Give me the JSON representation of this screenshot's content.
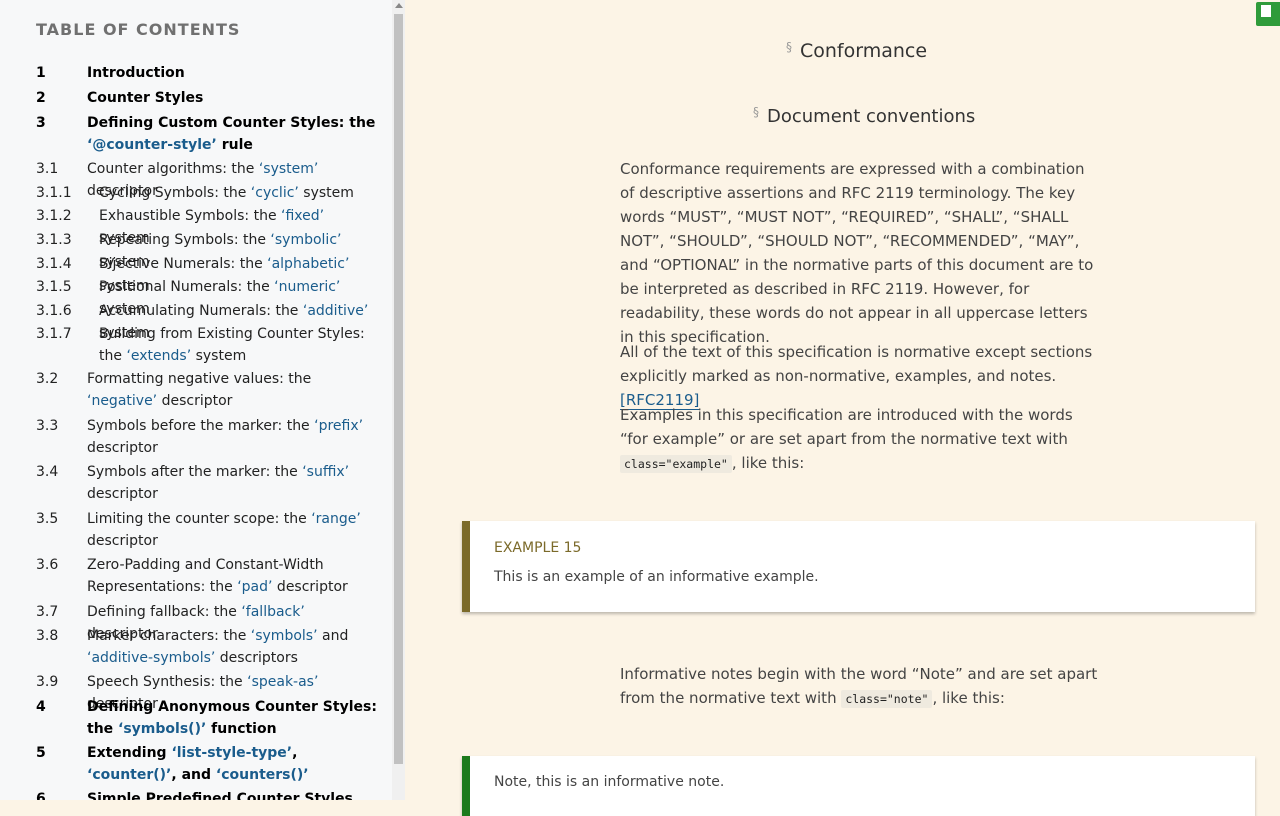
{
  "toc": {
    "title": "TABLE OF CONTENTS",
    "entries": [
      {
        "num": "1",
        "pre": "Introduction",
        "link": "",
        "post": ""
      },
      {
        "num": "2",
        "pre": "Counter Styles",
        "link": "",
        "post": ""
      },
      {
        "num": "3",
        "pre": "Defining Custom Counter Styles: the ",
        "link": "‘@counter-style’",
        "post": " rule"
      },
      {
        "num": "3.1",
        "pre": "Counter algorithms: the ",
        "link": "‘system’",
        "post": " descriptor"
      },
      {
        "num": "3.1.1",
        "pre": "Cycling Symbols: the ",
        "link": "‘cyclic’",
        "post": " system"
      },
      {
        "num": "3.1.2",
        "pre": "Exhaustible Symbols: the ",
        "link": "‘fixed’",
        "post": " system"
      },
      {
        "num": "3.1.3",
        "pre": "Repeating Symbols: the ",
        "link": "‘symbolic’",
        "post": " system"
      },
      {
        "num": "3.1.4",
        "pre": "Bijective Numerals: the ",
        "link": "‘alphabetic’",
        "post": " system"
      },
      {
        "num": "3.1.5",
        "pre": "Positional Numerals: the ",
        "link": "‘numeric’",
        "post": " system"
      },
      {
        "num": "3.1.6",
        "pre": "Accumulating Numerals: the ",
        "link": "‘additive’",
        "post": " system"
      },
      {
        "num": "3.1.7",
        "pre": "Building from Existing Counter Styles: the ",
        "link": "‘extends’",
        "post": " system"
      },
      {
        "num": "3.2",
        "pre": "Formatting negative values: the ",
        "link": "‘negative’",
        "post": " descriptor"
      },
      {
        "num": "3.3",
        "pre": "Symbols before the marker: the ",
        "link": "‘prefix’",
        "post": " descriptor"
      },
      {
        "num": "3.4",
        "pre": "Symbols after the marker: the ",
        "link": "‘suffix’",
        "post": " descriptor"
      },
      {
        "num": "3.5",
        "pre": "Limiting the counter scope: the ",
        "link": "‘range’",
        "post": " descriptor"
      },
      {
        "num": "3.6",
        "pre": "Zero-Padding and Constant-Width Representations: the ",
        "link": "‘pad’",
        "post": " descriptor"
      },
      {
        "num": "3.7",
        "pre": "Defining fallback: the ",
        "link": "‘fallback’",
        "post": " descriptor"
      },
      {
        "num": "3.8",
        "pre": "Marker characters: the ",
        "link": "‘symbols’",
        "post": " and ",
        "link2": "‘additive-symbols’",
        "post2": " descriptors"
      },
      {
        "num": "3.9",
        "pre": "Speech Synthesis: the ",
        "link": "‘speak-as’",
        "post": " descriptor"
      },
      {
        "num": "4",
        "pre": "Defining Anonymous Counter Styles: the ",
        "link": "‘symbols()’",
        "post": " function"
      },
      {
        "num": "5",
        "pre": "Extending ",
        "link": "‘list-style-type’",
        "post": ", ",
        "link2": "‘counter()’",
        "post2": ", and ",
        "link3": "‘counters()’",
        "post3": ""
      },
      {
        "num": "6",
        "pre": "Simple Predefined Counter Styles",
        "link": "",
        "post": ""
      }
    ]
  },
  "main": {
    "heading1": {
      "sect": "§",
      "text": "Conformance"
    },
    "heading2": {
      "sect": "§",
      "text": "Document conventions"
    },
    "para1": "Conformance requirements are expressed with a combination of descriptive assertions and RFC 2119 terminology. The key words “MUST”, “MUST NOT”, “REQUIRED”, “SHALL”, “SHALL NOT”, “SHOULD”, “SHOULD NOT”, “RECOMMENDED”, “MAY”, and “OPTIONAL” in the normative parts of this document are to be interpreted as described in RFC 2119. However, for readability, these words do not appear in all uppercase letters in this specification.",
    "para2": "All of the text of this specification is normative except sections explicitly marked as non-normative, examples, and notes.",
    "para2_ref": "[RFC2119]",
    "para3_pre": "Examples in this specification are introduced with the words “for example” or are set apart from the normative text with ",
    "para3_code": "class=\"example\"",
    "para3_post": ", like this:",
    "example": {
      "label": "EXAMPLE 15",
      "text": "This is an example of an informative example."
    },
    "para4_pre": "Informative notes begin with the word “Note” and are set apart from the normative text with ",
    "para4_code": "class=\"note\"",
    "para4_post": ", like this:",
    "note": {
      "text": "Note, this is an informative note."
    }
  },
  "colors": {
    "example_accent": "#7b6a2a",
    "note_accent": "#1c7a1c",
    "link": "#1a5c8c",
    "background": "#fcf4e6"
  }
}
